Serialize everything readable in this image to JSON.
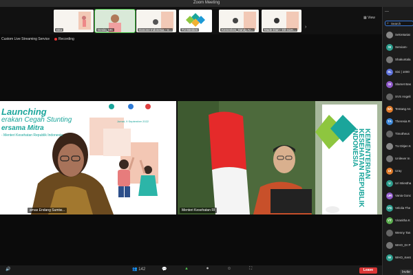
{
  "window": {
    "title": "Zoom Meeting"
  },
  "view_label": "View",
  "thumbnails": [
    {
      "name": "Dita"
    },
    {
      "name": "Desita_MC"
    },
    {
      "name": "Danone Indonesia - V..."
    },
    {
      "name": "TU Menkes"
    },
    {
      "name": "Kemenkes_Sandy Ar..."
    },
    {
      "name": "Made Dian - Dit GizK..."
    }
  ],
  "live": {
    "service": "Custom Live Streaming Service",
    "recording": "Recording"
  },
  "slide": {
    "title": "Launching",
    "line1": "erakan Cegah Stunting",
    "line2": "ersama Mitra",
    "line3": "- Menteri Kesehatan Republik Indonesia",
    "date": "Jumat, 9 September 2022"
  },
  "tiles": {
    "left_name": "amas Endang Sumiw...",
    "right_name": "Menteri Kesehatan RI",
    "banner_text": "KEMENTERIAN KESEHATAN REPUBLIK INDONESIA"
  },
  "search": {
    "placeholder": "Search"
  },
  "participants": [
    {
      "name": "Sekretariat",
      "initial": "",
      "color": "#888888"
    },
    {
      "name": "Serviam-",
      "initial": "SI",
      "color": "#2e9e8e"
    },
    {
      "name": "Shakuntala",
      "initial": "",
      "color": "#777777"
    },
    {
      "name": "Sisi | 1000",
      "initial": "SL",
      "color": "#5b6fd8"
    },
    {
      "name": "Slamet Bas",
      "initial": "SI",
      "color": "#8f59c9"
    },
    {
      "name": "SVS Angeli",
      "initial": "",
      "color": "#666666"
    },
    {
      "name": "Tentang An",
      "initial": "SA",
      "color": "#e07b2a"
    },
    {
      "name": "Theresia R",
      "initial": "TA",
      "color": "#3b86d6"
    },
    {
      "name": "Timotheus",
      "initial": "",
      "color": "#666666"
    },
    {
      "name": "TU Ditjen K",
      "initial": "",
      "color": "#888888"
    },
    {
      "name": "Unilever In",
      "initial": "",
      "color": "#777777"
    },
    {
      "name": "Uray",
      "initial": "UI",
      "color": "#e07b2a"
    },
    {
      "name": "Uri Wiestha",
      "initial": "U",
      "color": "#2e9e8e"
    },
    {
      "name": "Vania Gonc",
      "initial": "UR",
      "color": "#8f59c9"
    },
    {
      "name": "Velolia The",
      "initial": "VG",
      "color": "#2e9e8e"
    },
    {
      "name": "Viranitha K",
      "initial": "VT",
      "color": "#5cae4f"
    },
    {
      "name": "Wenny Tan",
      "initial": "",
      "color": "#666666"
    },
    {
      "name": "WHO_Dr P",
      "initial": "",
      "color": "#777777"
    },
    {
      "name": "WHO_Kent",
      "initial": "W",
      "color": "#2e9e8e"
    }
  ],
  "invite_label": "Invite",
  "toolbar": {
    "participants_count": "142",
    "leave_label": "Leave"
  }
}
